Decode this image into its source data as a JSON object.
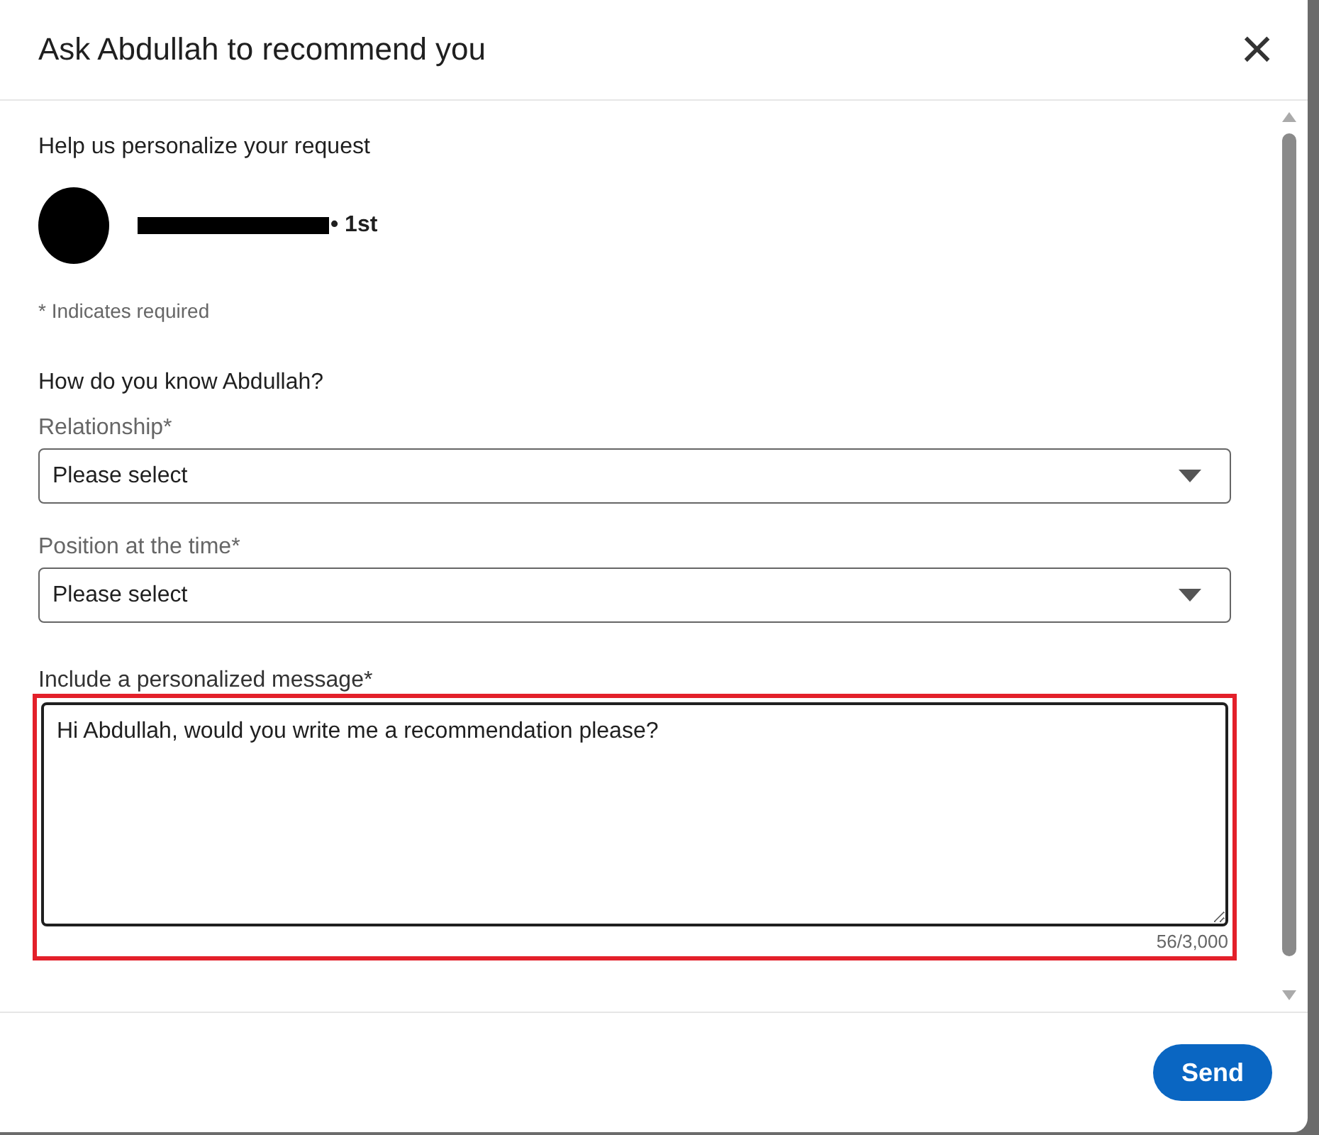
{
  "dialog": {
    "title": "Ask Abdullah to recommend you",
    "close": "×"
  },
  "intro": "Help us personalize your request",
  "person": {
    "redacted": true,
    "degree": "• 1st"
  },
  "required_note": "* Indicates required",
  "question": "How do you know Abdullah?",
  "selects": [
    {
      "label": "Relationship*",
      "value": "Please select"
    },
    {
      "label": "Position at the time*",
      "value": "Please select"
    }
  ],
  "message": {
    "label": "Include a personalized message*",
    "value": "Hi Abdullah, would you write me a recommendation please?",
    "counter": "56/3,000",
    "highlighted": true
  },
  "footer": {
    "send": "Send"
  }
}
